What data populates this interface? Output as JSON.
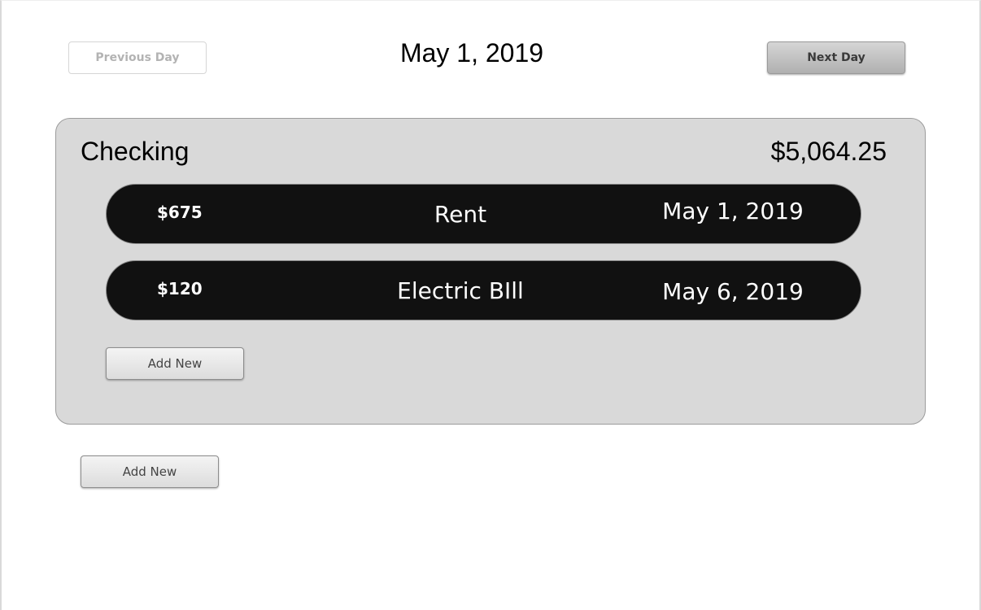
{
  "header": {
    "prev_label": "Previous Day",
    "date": "May 1, 2019",
    "next_label": "Next Day"
  },
  "account": {
    "name": "Checking",
    "balance": "$5,064.25",
    "transactions": [
      {
        "amount": "$675",
        "description": "Rent",
        "date": "May 1, 2019"
      },
      {
        "amount": "$120",
        "description": "Electric BIll",
        "date": "May 6, 2019"
      }
    ],
    "add_label": "Add New"
  },
  "footer": {
    "add_label": "Add New"
  },
  "colors": {
    "card_background": "#d9d9d9",
    "transaction_background": "#111111",
    "transaction_text": "#ffffff"
  }
}
